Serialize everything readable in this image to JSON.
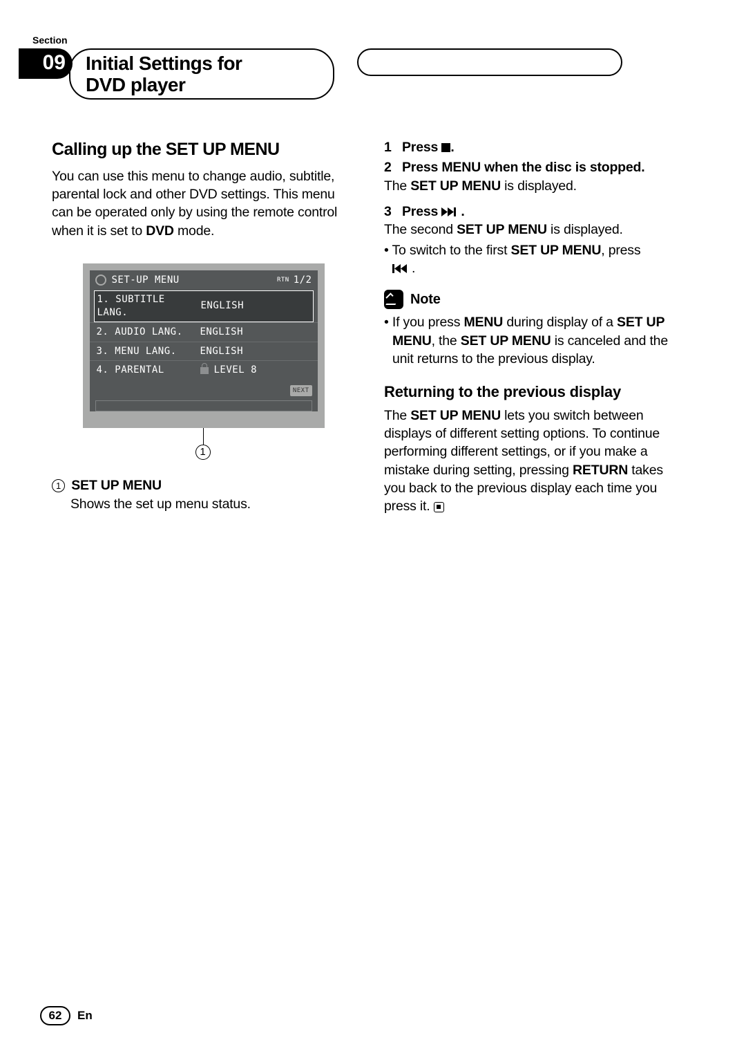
{
  "section_label": "Section",
  "section_number": "09",
  "chapter_title_line1": "Initial Settings for",
  "chapter_title_line2": "DVD player",
  "left": {
    "heading": "Calling up the SET UP MENU",
    "intro_part1": "You can use this menu to change audio, subtitle, parental lock and other DVD settings. This menu can be operated only by using the remote control when it is set to ",
    "intro_bold": "DVD",
    "intro_part2": " mode.",
    "menu": {
      "title": "SET-UP MENU",
      "rtn": "RTN",
      "page": "1/2",
      "rows": [
        {
          "label": "1. SUBTITLE LANG.",
          "value": "ENGLISH"
        },
        {
          "label": "2. AUDIO LANG.",
          "value": "ENGLISH"
        },
        {
          "label": "3. MENU LANG.",
          "value": "ENGLISH"
        },
        {
          "label": "4. PARENTAL",
          "value": "LEVEL 8"
        }
      ],
      "next": "NEXT"
    },
    "callout_number": "1",
    "legend_number": "1",
    "legend_title": "SET UP MENU",
    "legend_desc": "Shows the set up menu status."
  },
  "right": {
    "step1": {
      "num": "1",
      "label": "Press "
    },
    "step2": {
      "num": "2",
      "label_bold": "Press MENU when the disc is stopped.",
      "body_a": "The ",
      "body_b": "SET UP MENU",
      "body_c": " is displayed."
    },
    "step3": {
      "num": "3",
      "label": "Press ",
      "line1_a": "The second ",
      "line1_b": "SET UP MENU",
      "line1_c": " is displayed.",
      "bullet_a": "To switch to the first ",
      "bullet_b": "SET UP MENU",
      "bullet_c": ", press"
    },
    "note_label": "Note",
    "note": {
      "a": "If you press ",
      "b": "MENU",
      "c": " during display of a ",
      "d": "SET UP MENU",
      "e": ", the ",
      "f": "SET UP MENU",
      "g": " is canceled and the unit returns to the previous display."
    },
    "return_heading": "Returning to the previous display",
    "return_body_a": "The ",
    "return_body_b": "SET UP MENU",
    "return_body_c": " lets you switch between displays of different setting options. To continue performing different settings, or if you make a mistake during setting, pressing ",
    "return_body_d": "RETURN",
    "return_body_e": " takes you back to the previous display each time you press it. "
  },
  "footer": {
    "page": "62",
    "lang": "En"
  }
}
